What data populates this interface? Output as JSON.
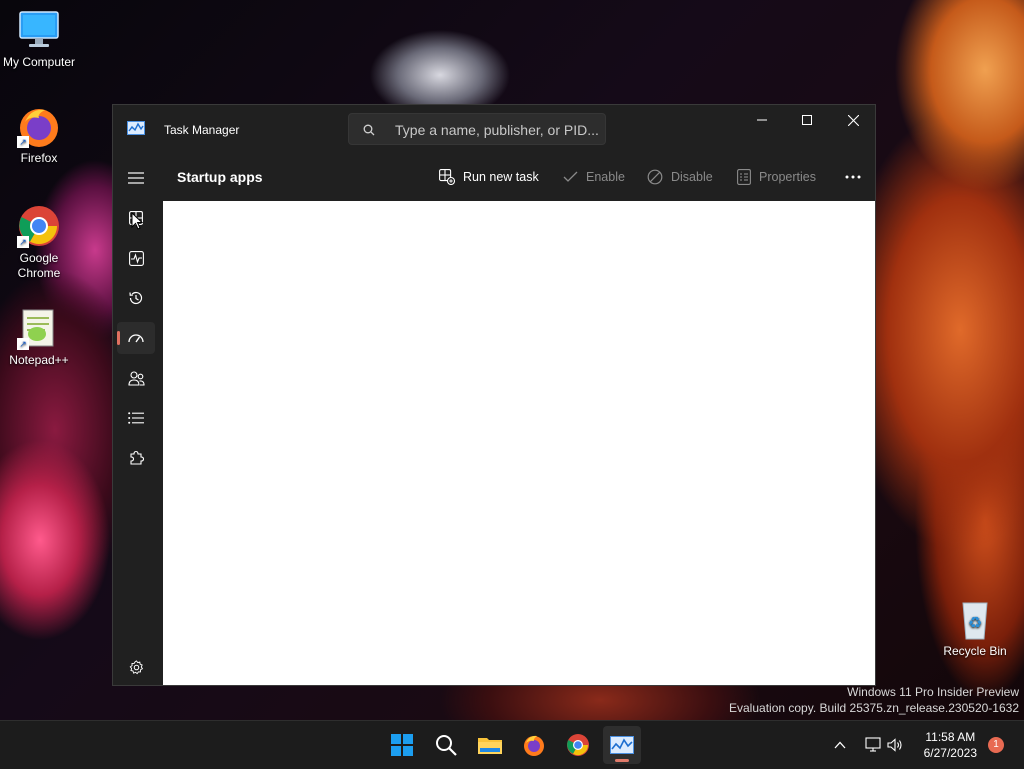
{
  "desktop": {
    "icons": [
      {
        "label": "My Computer"
      },
      {
        "label": "Firefox"
      },
      {
        "label": "Google Chrome"
      },
      {
        "label": "Notepad++"
      },
      {
        "label": "Recycle Bin"
      }
    ],
    "watermark": {
      "line1": "Windows 11 Pro Insider Preview",
      "line2": "Evaluation copy. Build 25375.zn_release.230520-1632"
    }
  },
  "window": {
    "title": "Task Manager",
    "search_placeholder": "Type a name, publisher, or PID...",
    "controls": {
      "minimize_icon": "minimize-icon",
      "maximize_icon": "maximize-icon",
      "close_icon": "close-icon"
    },
    "accent_color": "#e07060"
  },
  "sidebar": {
    "items": [
      {
        "name": "hamburger-menu",
        "icon": "hamburger-icon"
      },
      {
        "name": "processes",
        "icon": "processes-grid-icon"
      },
      {
        "name": "performance",
        "icon": "performance-pulse-icon"
      },
      {
        "name": "app-history",
        "icon": "history-icon"
      },
      {
        "name": "startup-apps",
        "icon": "speedometer-icon",
        "active": true
      },
      {
        "name": "users",
        "icon": "users-icon"
      },
      {
        "name": "details",
        "icon": "list-icon"
      },
      {
        "name": "services",
        "icon": "puzzle-icon"
      }
    ],
    "settings_icon": "gear-icon"
  },
  "commandbar": {
    "page_title": "Startup apps",
    "run_new_task": "Run new task",
    "enable": "Enable",
    "disable": "Disable",
    "properties": "Properties",
    "more_icon": "more-icon"
  },
  "taskbar": {
    "time": "11:58 AM",
    "date": "6/27/2023",
    "notification_count": "1",
    "apps": [
      "start",
      "search",
      "file-explorer",
      "firefox",
      "chrome",
      "task-manager"
    ]
  }
}
